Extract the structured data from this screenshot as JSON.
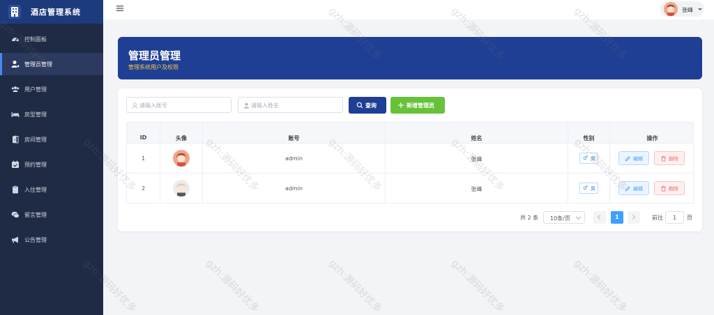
{
  "app": {
    "title": "酒店管理系统"
  },
  "sidebar": {
    "items": [
      {
        "label": "控制面板",
        "icon": "dashboard-icon"
      },
      {
        "label": "管理员管理",
        "icon": "user-cog-icon",
        "active": true
      },
      {
        "label": "用户管理",
        "icon": "users-icon"
      },
      {
        "label": "房型管理",
        "icon": "bed-icon"
      },
      {
        "label": "房间管理",
        "icon": "door-icon"
      },
      {
        "label": "预约管理",
        "icon": "calendar-icon"
      },
      {
        "label": "入住管理",
        "icon": "clipboard-icon"
      },
      {
        "label": "留言管理",
        "icon": "comments-icon"
      },
      {
        "label": "公告管理",
        "icon": "megaphone-icon"
      }
    ]
  },
  "topbar": {
    "user_name": "张峰"
  },
  "banner": {
    "title": "管理员管理",
    "subtitle": "管理系统用户及权限"
  },
  "search": {
    "account_placeholder": "请输入账号",
    "name_placeholder": "请输入姓名",
    "account_value": "",
    "name_value": "",
    "query_label": "查询",
    "add_label": "新增管理员"
  },
  "table": {
    "headers": [
      "ID",
      "头像",
      "账号",
      "姓名",
      "性别",
      "操作"
    ],
    "rows": [
      {
        "id": "1",
        "account": "admin",
        "name": "张峰",
        "gender_symbol": "♂",
        "gender": "男",
        "edit": "编辑",
        "delete": "删除"
      },
      {
        "id": "2",
        "account": "admin",
        "name": "张峰",
        "gender_symbol": "♂",
        "gender": "男",
        "edit": "编辑",
        "delete": "删除"
      }
    ]
  },
  "pagination": {
    "total": "共 2 条",
    "page_size": "10条/页",
    "current": "1",
    "goto_label": "前往",
    "goto_value": "1",
    "page_unit": "页"
  },
  "watermark": "gzh:源码好优多",
  "colors": {
    "sidebar": "#1f2a44",
    "brand": "#1d3a7c",
    "banner": "#1f3f94",
    "accent": "#409eff",
    "success": "#67c23a",
    "danger": "#f56c6c"
  }
}
